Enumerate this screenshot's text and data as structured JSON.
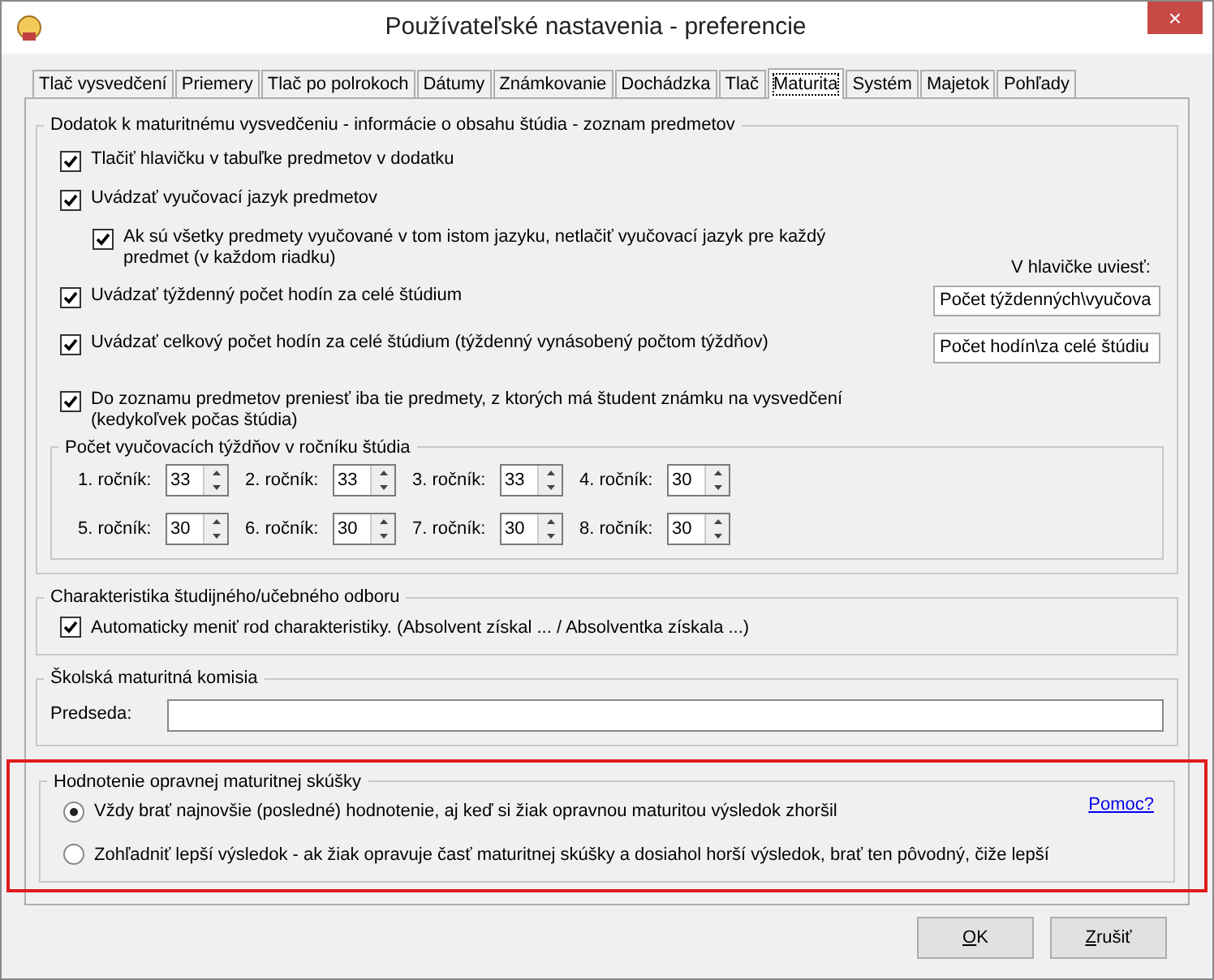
{
  "window": {
    "title": "Používateľské nastavenia - preferencie",
    "close": "×"
  },
  "tabs": [
    {
      "label": "Tlač vysvedčení",
      "selected": false
    },
    {
      "label": "Priemery",
      "selected": false
    },
    {
      "label": "Tlač po polrokoch",
      "selected": false
    },
    {
      "label": "Dátumy",
      "selected": false
    },
    {
      "label": "Známkovanie",
      "selected": false
    },
    {
      "label": "Dochádzka",
      "selected": false
    },
    {
      "label": "Tlač",
      "selected": false
    },
    {
      "label": "Maturita",
      "selected": true
    },
    {
      "label": "Systém",
      "selected": false
    },
    {
      "label": "Majetok",
      "selected": false
    },
    {
      "label": "Pohľady",
      "selected": false
    }
  ],
  "supplement_group": {
    "legend": "Dodatok k maturitnému vysvedčeniu - informácie o obsahu štúdia - zoznam predmetov",
    "header_label": "V hlavičke uviesť:",
    "options": [
      {
        "label": "Tlačiť hlavičku v tabuľke predmetov v dodatku",
        "checked": true,
        "indent": false
      },
      {
        "label": "Uvádzať vyučovací jazyk predmetov",
        "checked": true,
        "indent": false
      },
      {
        "label": "Ak sú všetky predmety vyučované v tom istom jazyku, netlačiť vyučovací jazyk pre každý predmet (v každom riadku)",
        "checked": true,
        "indent": true
      },
      {
        "label": "Uvádzať týždenný počet hodín za celé štúdium",
        "checked": true,
        "indent": false,
        "header_value": "Počet týždenných\\vyučova"
      },
      {
        "label": "Uvádzať celkový počet hodín za celé štúdium (týždenný vynásobený počtom týždňov)",
        "checked": true,
        "indent": false,
        "header_value": "Počet hodín\\za celé štúdiu"
      },
      {
        "label": "Do zoznamu predmetov preniesť iba tie predmety, z ktorých má študent známku na vysvedčení (kedykoľvek počas štúdia)",
        "checked": true,
        "indent": false
      }
    ],
    "weeks_group": {
      "legend": "Počet vyučovacích týždňov v ročníku štúdia",
      "years": [
        {
          "label": "1. ročník:",
          "value": "33"
        },
        {
          "label": "2. ročník:",
          "value": "33"
        },
        {
          "label": "3. ročník:",
          "value": "33"
        },
        {
          "label": "4. ročník:",
          "value": "30"
        },
        {
          "label": "5. ročník:",
          "value": "30"
        },
        {
          "label": "6. ročník:",
          "value": "30"
        },
        {
          "label": "7. ročník:",
          "value": "30"
        },
        {
          "label": "8. ročník:",
          "value": "30"
        }
      ]
    }
  },
  "characteristics_group": {
    "legend": "Charakteristika študijného/učebného odboru",
    "option": {
      "label": "Automaticky meniť rod charakteristiky. (Absolvent získal ... / Absolventka získala ...)",
      "checked": true
    }
  },
  "committee_group": {
    "legend": "Školská maturitná komisia",
    "chair_label": "Predseda:"
  },
  "retake_group": {
    "legend": "Hodnotenie opravnej maturitnej skúšky",
    "highlighted": true,
    "help_link": "Pomoc?",
    "options": [
      {
        "label": "Vždy brať najnovšie (posledné) hodnotenie, aj keď si žiak opravnou maturitou výsledok zhoršil",
        "selected": true
      },
      {
        "label": "Zohľadniť lepší výsledok - ak žiak opravuje časť maturitnej skúšky a dosiahol horší výsledok, brať ten pôvodný, čiže lepší",
        "selected": false
      }
    ]
  },
  "buttons": [
    {
      "label": "OK",
      "mnemonic": true
    },
    {
      "label": "Zrušiť",
      "mnemonic": true
    }
  ]
}
